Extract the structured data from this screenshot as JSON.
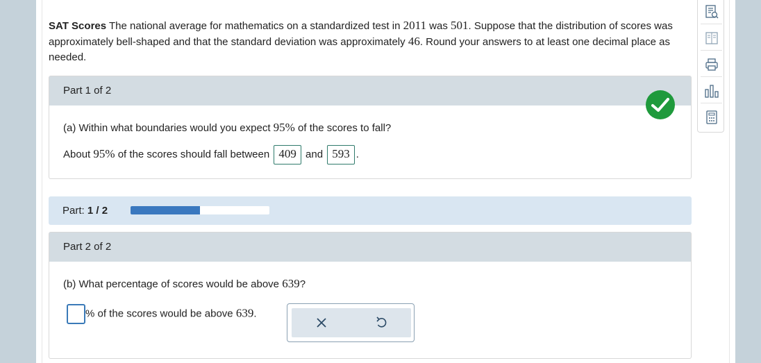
{
  "problem": {
    "title": "SAT Scores",
    "text_1": "The national average for mathematics on a standardized test in",
    "year": "2011",
    "text_2": "was",
    "mean": "501",
    "text_3": ". Suppose that the distribution of scores was approximately bell-shaped and that the standard deviation was approximately",
    "sd": "46",
    "text_4": ". Round your answers to at least one decimal place as needed."
  },
  "part1": {
    "header": "Part 1 of 2",
    "question_prefix": "(a) Within what boundaries would you expect",
    "question_pct": "95%",
    "question_suffix": "of the scores to fall?",
    "answer_prefix": "About",
    "answer_pct": "95%",
    "answer_mid": "of the scores should fall between",
    "lower": "409",
    "and": "and",
    "upper": "593",
    "period": ".",
    "status": "correct"
  },
  "progress": {
    "label": "Part:",
    "value": "1 / 2",
    "fraction": 0.5,
    "color": "#3a78bf"
  },
  "part2": {
    "header": "Part 2 of 2",
    "question_prefix": "(b) What percentage of scores would be above",
    "question_value": "639",
    "question_suffix": "?",
    "answer_value": "",
    "answer_suffix": "% of the scores would be above",
    "answer_number": "639",
    "answer_period": "."
  },
  "tools": {
    "clear_icon": "x-icon",
    "undo_icon": "undo-icon"
  },
  "side_tools": [
    "ask-question-icon",
    "textbook-icon",
    "print-icon",
    "statistics-icon",
    "calculator-icon"
  ],
  "colors": {
    "check_green": "#1f9a3c",
    "header_gray": "#d3dce2",
    "progress_bg": "#d9e6f2",
    "answer_border": "#2f7a6b"
  }
}
